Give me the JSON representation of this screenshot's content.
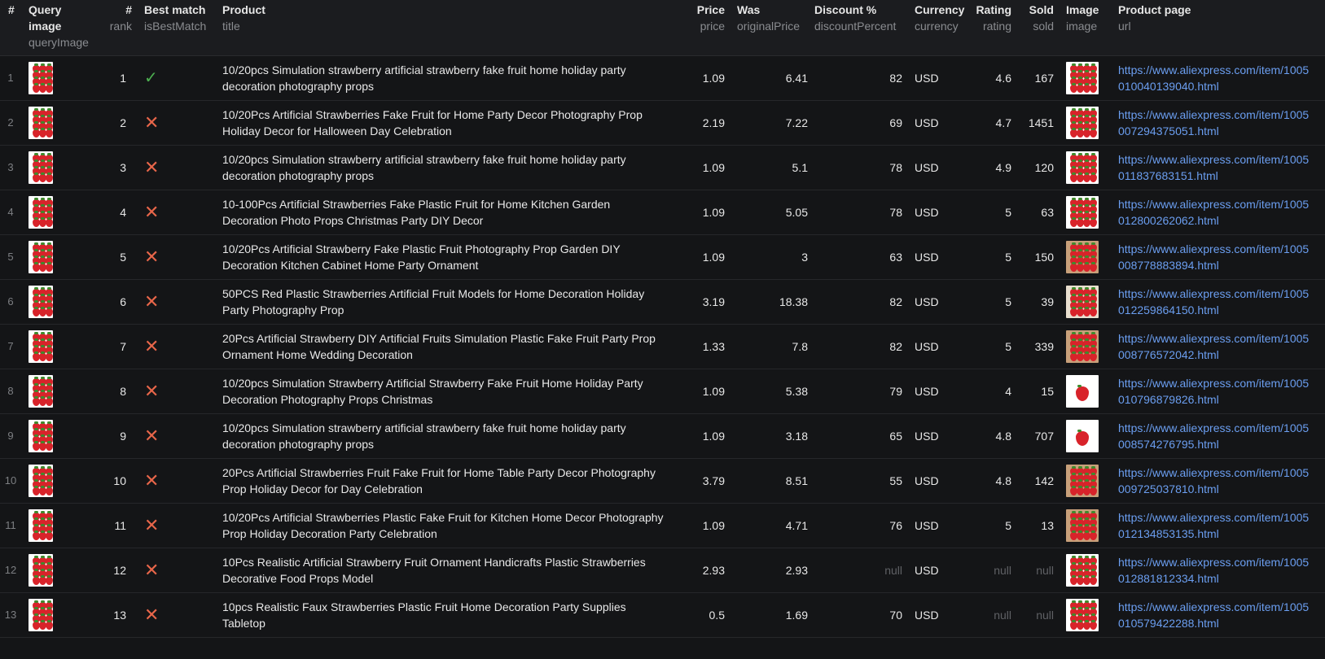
{
  "headers": [
    {
      "title": "#",
      "key": ""
    },
    {
      "title": "Query image",
      "key": "queryImage"
    },
    {
      "title": "#",
      "key": "rank"
    },
    {
      "title": "Best match",
      "key": "isBestMatch"
    },
    {
      "title": "Product",
      "key": "title"
    },
    {
      "title": "Price",
      "key": "price"
    },
    {
      "title": "Was",
      "key": "originalPrice"
    },
    {
      "title": "Discount %",
      "key": "discountPercent"
    },
    {
      "title": "Currency",
      "key": "currency"
    },
    {
      "title": "Rating",
      "key": "rating"
    },
    {
      "title": "Sold",
      "key": "sold"
    },
    {
      "title": "Image",
      "key": "image"
    },
    {
      "title": "Product page",
      "key": "url"
    }
  ],
  "rows": [
    {
      "idx": "1",
      "rank": "1",
      "best": true,
      "title_1": "10/20pcs Simulation strawberry artificial strawberry fake fruit home holiday party",
      "title_2": "decoration photography props",
      "price": "1.09",
      "was": "6.41",
      "discount": "82",
      "currency": "USD",
      "rating": "4.6",
      "sold": "167",
      "url_1": "https://www.aliexpress.com/item/1005",
      "url_2": "010040139040.html",
      "img": "tray"
    },
    {
      "idx": "2",
      "rank": "2",
      "best": false,
      "title_1": "10/20Pcs Artificial Strawberries Fake Fruit for Home Party Decor Photography Prop",
      "title_2": "Holiday Decor for Halloween Day Celebration",
      "price": "2.19",
      "was": "7.22",
      "discount": "69",
      "currency": "USD",
      "rating": "4.7",
      "sold": "1451",
      "url_1": "https://www.aliexpress.com/item/1005",
      "url_2": "007294375051.html",
      "img": "tray"
    },
    {
      "idx": "3",
      "rank": "3",
      "best": false,
      "title_1": "10/20pcs Simulation strawberry artificial strawberry fake fruit home holiday party",
      "title_2": "decoration photography props",
      "price": "1.09",
      "was": "5.1",
      "discount": "78",
      "currency": "USD",
      "rating": "4.9",
      "sold": "120",
      "url_1": "https://www.aliexpress.com/item/1005",
      "url_2": "011837683151.html",
      "img": "tray"
    },
    {
      "idx": "4",
      "rank": "4",
      "best": false,
      "title_1": "10-100Pcs Artificial Strawberries Fake Plastic Fruit for Home Kitchen Garden",
      "title_2": "Decoration Photo Props Christmas Party DIY Decor",
      "price": "1.09",
      "was": "5.05",
      "discount": "78",
      "currency": "USD",
      "rating": "5",
      "sold": "63",
      "url_1": "https://www.aliexpress.com/item/1005",
      "url_2": "012800262062.html",
      "img": "tray"
    },
    {
      "idx": "5",
      "rank": "5",
      "best": false,
      "title_1": "10/20Pcs Artificial Strawberry Fake Plastic Fruit Photography Prop Garden DIY",
      "title_2": "Decoration Kitchen Cabinet Home Party Ornament",
      "price": "1.09",
      "was": "3",
      "discount": "63",
      "currency": "USD",
      "rating": "5",
      "sold": "150",
      "url_1": "https://www.aliexpress.com/item/1005",
      "url_2": "008778883894.html",
      "img": "basket"
    },
    {
      "idx": "6",
      "rank": "6",
      "best": false,
      "title_1": "50PCS Red Plastic Strawberries Artificial Fruit Models for Home Decoration Holiday",
      "title_2": "Party Photography Prop",
      "price": "3.19",
      "was": "18.38",
      "discount": "82",
      "currency": "USD",
      "rating": "5",
      "sold": "39",
      "url_1": "https://www.aliexpress.com/item/1005",
      "url_2": "012259864150.html",
      "img": "bowl"
    },
    {
      "idx": "7",
      "rank": "7",
      "best": false,
      "title_1": "20Pcs Artificial Strawberry DIY Artificial Fruits Simulation Plastic Fake Fruit Party Prop",
      "title_2": "Ornament Home Wedding Decoration",
      "price": "1.33",
      "was": "7.8",
      "discount": "82",
      "currency": "USD",
      "rating": "5",
      "sold": "339",
      "url_1": "https://www.aliexpress.com/item/1005",
      "url_2": "008776572042.html",
      "img": "basket"
    },
    {
      "idx": "8",
      "rank": "8",
      "best": false,
      "title_1": "10/20pcs Simulation Strawberry Artificial Strawberry Fake Fruit Home Holiday Party",
      "title_2": "Decoration Photography Props Christmas",
      "price": "1.09",
      "was": "5.38",
      "discount": "79",
      "currency": "USD",
      "rating": "4",
      "sold": "15",
      "url_1": "https://www.aliexpress.com/item/1005",
      "url_2": "010796879826.html",
      "img": "single"
    },
    {
      "idx": "9",
      "rank": "9",
      "best": false,
      "title_1": "10/20pcs Simulation strawberry artificial strawberry fake fruit home holiday party",
      "title_2": "decoration photography props",
      "price": "1.09",
      "was": "3.18",
      "discount": "65",
      "currency": "USD",
      "rating": "4.8",
      "sold": "707",
      "url_1": "https://www.aliexpress.com/item/1005",
      "url_2": "008574276795.html",
      "img": "single"
    },
    {
      "idx": "10",
      "rank": "10",
      "best": false,
      "title_1": "20Pcs Artificial Strawberries Fruit Fake Fruit for Home Table Party Decor Photography",
      "title_2": "Prop Holiday Decor for Day Celebration",
      "price": "3.79",
      "was": "8.51",
      "discount": "55",
      "currency": "USD",
      "rating": "4.8",
      "sold": "142",
      "url_1": "https://www.aliexpress.com/item/1005",
      "url_2": "009725037810.html",
      "img": "basket"
    },
    {
      "idx": "11",
      "rank": "11",
      "best": false,
      "title_1": "10/20Pcs Artificial Strawberries Plastic Fake Fruit for Kitchen Home Decor Photography",
      "title_2": "Prop Holiday Decoration Party Celebration",
      "price": "1.09",
      "was": "4.71",
      "discount": "76",
      "currency": "USD",
      "rating": "5",
      "sold": "13",
      "url_1": "https://www.aliexpress.com/item/1005",
      "url_2": "012134853135.html",
      "img": "split"
    },
    {
      "idx": "12",
      "rank": "12",
      "best": false,
      "title_1": "10Pcs Realistic Artificial Strawberry Fruit Ornament Handicrafts Plastic Strawberries",
      "title_2": "Decorative Food Props Model",
      "price": "2.93",
      "was": "2.93",
      "discount": "null",
      "currency": "USD",
      "rating": "null",
      "sold": "null",
      "url_1": "https://www.aliexpress.com/item/1005",
      "url_2": "012881812334.html",
      "img": "rows"
    },
    {
      "idx": "13",
      "rank": "13",
      "best": false,
      "title_1": "10pcs Realistic Faux Strawberries Plastic Fruit Home Decoration Party Supplies",
      "title_2": "Tabletop",
      "price": "0.5",
      "was": "1.69",
      "discount": "70",
      "currency": "USD",
      "rating": "null",
      "sold": "null",
      "url_1": "https://www.aliexpress.com/item/1005",
      "url_2": "010579422288.html",
      "img": "rows"
    }
  ],
  "colors": {
    "link": "#6b9ef0",
    "check": "#4caf50",
    "cross": "#e8664a",
    "null": "#5f6165"
  }
}
